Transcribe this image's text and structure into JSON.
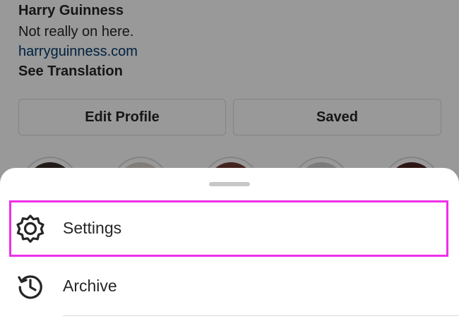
{
  "profile": {
    "name": "Harry Guinness",
    "bio": "Not really on here.",
    "link": "harryguinness.com",
    "translate_label": "See Translation",
    "edit_profile_label": "Edit Profile",
    "saved_label": "Saved"
  },
  "sheet": {
    "items": [
      {
        "label": "Settings",
        "icon": "gear-icon"
      },
      {
        "label": "Archive",
        "icon": "archive-history-icon"
      }
    ]
  },
  "colors": {
    "highlight_outline": "#ee2fe8",
    "text": "#262626",
    "link": "#00376b",
    "overlay": "rgba(0,0,0,0.4)"
  }
}
